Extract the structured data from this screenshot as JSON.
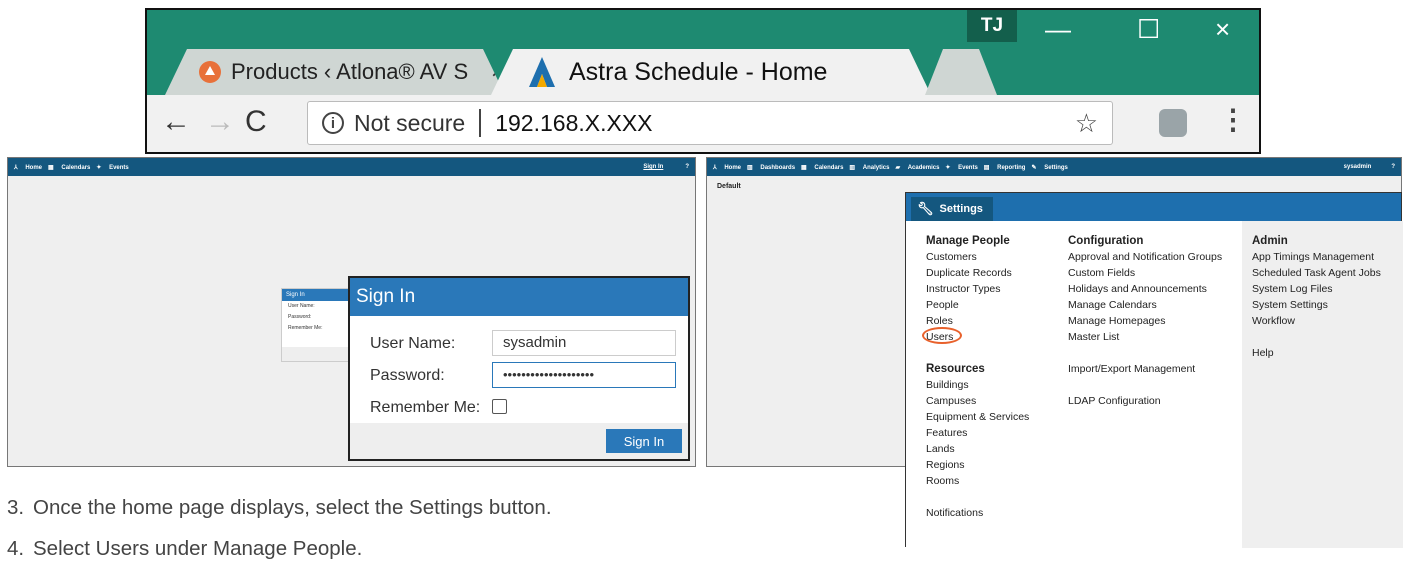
{
  "browser": {
    "tabs": [
      {
        "label": "Products ‹ Atlona® AV S",
        "label_faded": "‹",
        "icon": "atlona-icon"
      },
      {
        "label": "Astra Schedule - Home",
        "icon": "astra-icon"
      }
    ],
    "profile_initials": "TJ",
    "security_label": "Not secure",
    "url": "192.168.X.XXX",
    "close_glyph": "×",
    "min_glyph": "—",
    "max_glyph": "☐"
  },
  "left_app": {
    "nav": [
      "Home",
      "Calendars",
      "Events"
    ],
    "signin_link": "Sign In",
    "help": "?",
    "mini_dialog": {
      "title": "Sign In",
      "rows": [
        "User Name:",
        "Password:",
        "Remember Me:"
      ]
    },
    "signin_dialog": {
      "title": "Sign In",
      "user_label": "User Name:",
      "user_value": "sysadmin",
      "password_label": "Password:",
      "password_value": "••••••••••••••••••••",
      "remember_label": "Remember Me:",
      "button": "Sign In"
    }
  },
  "right_app": {
    "nav": [
      "Home",
      "Dashboards",
      "Calendars",
      "Analytics",
      "Academics",
      "Events",
      "Reporting",
      "Settings"
    ],
    "user": "sysadmin",
    "help": "?",
    "default_label": "Default",
    "settings": {
      "title": "Settings",
      "manage_people": {
        "heading": "Manage People",
        "items": [
          "Customers",
          "Duplicate Records",
          "Instructor Types",
          "People",
          "Roles",
          "Users"
        ]
      },
      "resources": {
        "heading": "Resources",
        "items": [
          "Buildings",
          "Campuses",
          "Equipment & Services",
          "Features",
          "Lands",
          "Regions",
          "Rooms"
        ]
      },
      "notifications": "Notifications",
      "configuration": {
        "heading": "Configuration",
        "items": [
          "Approval and Notification Groups",
          "Custom Fields",
          "Holidays and Announcements",
          "Manage Calendars",
          "Manage Homepages",
          "Master List"
        ]
      },
      "import_export": "Import/Export Management",
      "ldap": "LDAP Configuration",
      "admin": {
        "heading": "Admin",
        "items": [
          "App Timings Management",
          "Scheduled Task Agent Jobs",
          "System Log Files",
          "System Settings",
          "Workflow"
        ]
      },
      "help": "Help"
    }
  },
  "instructions": {
    "step3_num": "3.",
    "step3": "Once the home page displays, select the Settings button.",
    "step4_num": "4.",
    "step4": "Select Users under Manage People."
  },
  "colors": {
    "chrome_green": "#1e8a71",
    "app_bar": "#14577f",
    "dialog_blue": "#2a78b9",
    "highlight_orange": "#e8612c"
  }
}
